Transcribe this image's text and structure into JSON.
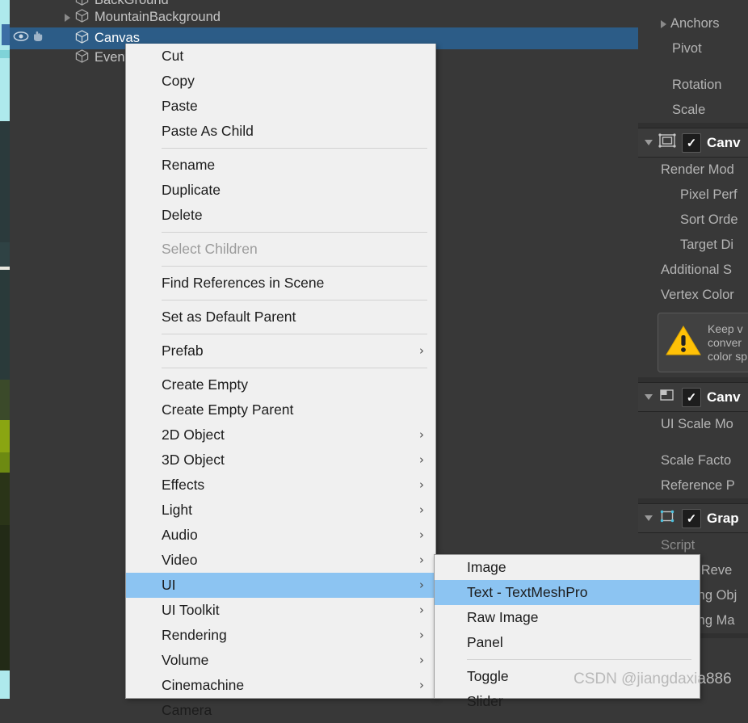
{
  "hierarchy": {
    "rows": [
      {
        "label": "BackGround",
        "indent": 2,
        "expandable": false,
        "selected": false,
        "clipped_top": true
      },
      {
        "label": "MountainBackground",
        "indent": 1,
        "expandable": true,
        "selected": false,
        "clipped_top": false
      },
      {
        "label": "Canvas",
        "indent": 2,
        "expandable": false,
        "selected": true,
        "clipped_top": false
      },
      {
        "label": "EventSystem",
        "indent": 2,
        "expandable": false,
        "selected": false,
        "clipped_top": false
      }
    ],
    "visibility_icons": {
      "eye": "eye-icon",
      "hand": "hand-icon"
    },
    "selection_color": "#2c5c87"
  },
  "context_menu": {
    "highlight_color": "#8cc4f2",
    "groups": [
      {
        "items": [
          {
            "label": "Cut",
            "submenu": false,
            "disabled": false,
            "highlighted": false
          },
          {
            "label": "Copy",
            "submenu": false,
            "disabled": false,
            "highlighted": false
          },
          {
            "label": "Paste",
            "submenu": false,
            "disabled": false,
            "highlighted": false
          },
          {
            "label": "Paste As Child",
            "submenu": false,
            "disabled": false,
            "highlighted": false
          }
        ]
      },
      {
        "items": [
          {
            "label": "Rename",
            "submenu": false,
            "disabled": false,
            "highlighted": false
          },
          {
            "label": "Duplicate",
            "submenu": false,
            "disabled": false,
            "highlighted": false
          },
          {
            "label": "Delete",
            "submenu": false,
            "disabled": false,
            "highlighted": false
          }
        ]
      },
      {
        "items": [
          {
            "label": "Select Children",
            "submenu": false,
            "disabled": true,
            "highlighted": false
          }
        ]
      },
      {
        "items": [
          {
            "label": "Find References in Scene",
            "submenu": false,
            "disabled": false,
            "highlighted": false
          }
        ]
      },
      {
        "items": [
          {
            "label": "Set as Default Parent",
            "submenu": false,
            "disabled": false,
            "highlighted": false
          }
        ]
      },
      {
        "items": [
          {
            "label": "Prefab",
            "submenu": true,
            "disabled": false,
            "highlighted": false
          }
        ]
      },
      {
        "items": [
          {
            "label": "Create Empty",
            "submenu": false,
            "disabled": false,
            "highlighted": false
          },
          {
            "label": "Create Empty Parent",
            "submenu": false,
            "disabled": false,
            "highlighted": false
          },
          {
            "label": "2D Object",
            "submenu": true,
            "disabled": false,
            "highlighted": false
          },
          {
            "label": "3D Object",
            "submenu": true,
            "disabled": false,
            "highlighted": false
          },
          {
            "label": "Effects",
            "submenu": true,
            "disabled": false,
            "highlighted": false
          },
          {
            "label": "Light",
            "submenu": true,
            "disabled": false,
            "highlighted": false
          },
          {
            "label": "Audio",
            "submenu": true,
            "disabled": false,
            "highlighted": false
          },
          {
            "label": "Video",
            "submenu": true,
            "disabled": false,
            "highlighted": false
          },
          {
            "label": "UI",
            "submenu": true,
            "disabled": false,
            "highlighted": true
          },
          {
            "label": "UI Toolkit",
            "submenu": true,
            "disabled": false,
            "highlighted": false
          },
          {
            "label": "Rendering",
            "submenu": true,
            "disabled": false,
            "highlighted": false
          },
          {
            "label": "Volume",
            "submenu": true,
            "disabled": false,
            "highlighted": false
          },
          {
            "label": "Cinemachine",
            "submenu": true,
            "disabled": false,
            "highlighted": false
          },
          {
            "label": "Camera",
            "submenu": false,
            "disabled": false,
            "highlighted": false
          }
        ]
      }
    ]
  },
  "sub_menu": {
    "groups": [
      {
        "items": [
          {
            "label": "Image",
            "highlighted": false
          },
          {
            "label": "Text - TextMeshPro",
            "highlighted": true
          },
          {
            "label": "Raw Image",
            "highlighted": false
          },
          {
            "label": "Panel",
            "highlighted": false
          }
        ]
      },
      {
        "items": [
          {
            "label": "Toggle",
            "highlighted": false
          },
          {
            "label": "Slider",
            "highlighted": false
          }
        ]
      }
    ]
  },
  "inspector": {
    "rect_transform_fields": [
      {
        "label": "Anchors",
        "expandable": true
      },
      {
        "label": "Pivot",
        "expandable": false
      }
    ],
    "transform_fields": [
      {
        "label": "Rotation"
      },
      {
        "label": "Scale"
      }
    ],
    "components": [
      {
        "name": "Canvas",
        "icon": "canvas-icon",
        "enabled": true,
        "fields": [
          {
            "label": "Render Mode",
            "indent": 1
          },
          {
            "label": "Pixel Perfect",
            "indent": 2
          },
          {
            "label": "Sort Order",
            "indent": 2
          },
          {
            "label": "Target Display",
            "indent": 2
          },
          {
            "label": "Additional Shader Channels",
            "indent": 1
          },
          {
            "label": "Vertex Color Always In Gamma Color Space",
            "indent": 1
          }
        ],
        "warning": {
          "icon": "warning-triangle-icon",
          "lines": [
            "Keep v",
            "conver",
            "color sp"
          ]
        }
      },
      {
        "name": "Canvas Scaler",
        "icon": "canvas-scaler-icon",
        "enabled": true,
        "fields": [
          {
            "label": "UI Scale Mode",
            "indent": 1
          },
          {
            "label": "Scale Factor",
            "indent": 1
          },
          {
            "label": "Reference Pixels Per Unit",
            "indent": 1
          }
        ]
      },
      {
        "name": "Graphic Raycaster",
        "icon": "graphic-raycaster-icon",
        "enabled": true,
        "fields": [
          {
            "label": "Script",
            "indent": 1,
            "disabled": true
          },
          {
            "label": "Ignore Reversed Graphics",
            "indent": 1
          },
          {
            "label": "Blocking Objects",
            "indent": 1
          },
          {
            "label": "Blocking Mask",
            "indent": 1
          }
        ]
      }
    ]
  },
  "watermark": {
    "text": "CSDN @jiangdaxia886"
  },
  "clipped_inspector_labels": {
    "canvas_header": "Canv",
    "render_mode": "Render Mod",
    "pixel_perfect": "Pixel Perf",
    "sort_order": "Sort Orde",
    "target_display": "Target Di",
    "additional_shader": "Additional S",
    "vertex_color": "Vertex Color",
    "warn_l1": "Keep v",
    "warn_l2": "conver",
    "warn_l3": "color sp",
    "scaler_header": "Canv",
    "ui_scale_mode": "UI Scale Mo",
    "scale_factor": "Scale Facto",
    "reference_pixels": "Reference P",
    "raycaster_header": "Grap",
    "script": "Script",
    "ignore_reversed": "e Reve",
    "blocking_objects": "ing Obj",
    "blocking_mask": "ing Ma"
  }
}
